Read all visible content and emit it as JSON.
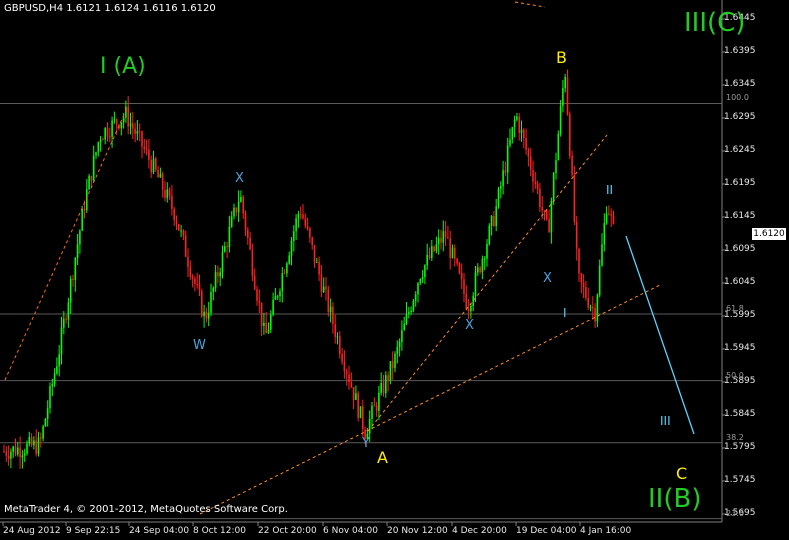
{
  "header": {
    "title": "GBPUSD,H4  1.6121 1.6124 1.6116 1.6120"
  },
  "footer": {
    "copyright": "MetaTrader 4, © 2001-2012, MetaQuotes Software Corp."
  },
  "current_price": "1.6120",
  "y_axis": [
    "1.6445",
    "1.6395",
    "1.6345",
    "1.6295",
    "1.6245",
    "1.6195",
    "1.6145",
    "1.6095",
    "1.6045",
    "1.5995",
    "1.5945",
    "1.5895",
    "1.5845",
    "1.5795",
    "1.5745",
    "1.5695"
  ],
  "x_axis": [
    "24 Aug 2012",
    "9 Sep 22:15",
    "24 Sep 04:00",
    "8 Oct 12:00",
    "22 Oct 20:00",
    "6 Nov 04:00",
    "20 Nov 12:00",
    "4 Dec 20:00",
    "19 Dec 04:00",
    "4 Jan 16:00"
  ],
  "fib_levels": [
    {
      "label": "100.0",
      "price": 1.6317
    },
    {
      "label": "61.8",
      "price": 1.5998
    },
    {
      "label": "50.0",
      "price": 1.5897
    },
    {
      "label": "38.2",
      "price": 1.5803
    },
    {
      "label": "23.6",
      "price": 1.5688
    }
  ],
  "wave_labels": {
    "iiic": "III(C)",
    "ia": "I (A)",
    "iib": "II(B)",
    "b": "B",
    "a": "A",
    "c": "C",
    "w": "W",
    "x1": "X",
    "y": "Y",
    "x2": "X",
    "x3": "X",
    "i": "I",
    "ii": "II",
    "iii": "III"
  },
  "colors": {
    "background": "#000000",
    "bull": "#00ff00",
    "bear": "#ff2020",
    "trend": "#ff8c1a",
    "projection": "#55d4ff",
    "fib": "#5a5a5a"
  },
  "chart_data": {
    "type": "candlestick",
    "symbol": "GBPUSD",
    "timeframe": "H4",
    "ylim": [
      1.568,
      1.647
    ],
    "series": [
      {
        "name": "price",
        "x": [
          "24 Aug 2012",
          "9 Sep 22:15",
          "24 Sep 04:00",
          "8 Oct 12:00",
          "22 Oct 20:00",
          "6 Nov 04:00",
          "20 Nov 12:00",
          "4 Dec 20:00",
          "19 Dec 04:00",
          "4 Jan 16:00"
        ],
        "values": [
          1.579,
          1.619,
          1.625,
          1.599,
          1.612,
          1.583,
          1.601,
          1.615,
          1.62,
          1.612
        ]
      }
    ]
  }
}
